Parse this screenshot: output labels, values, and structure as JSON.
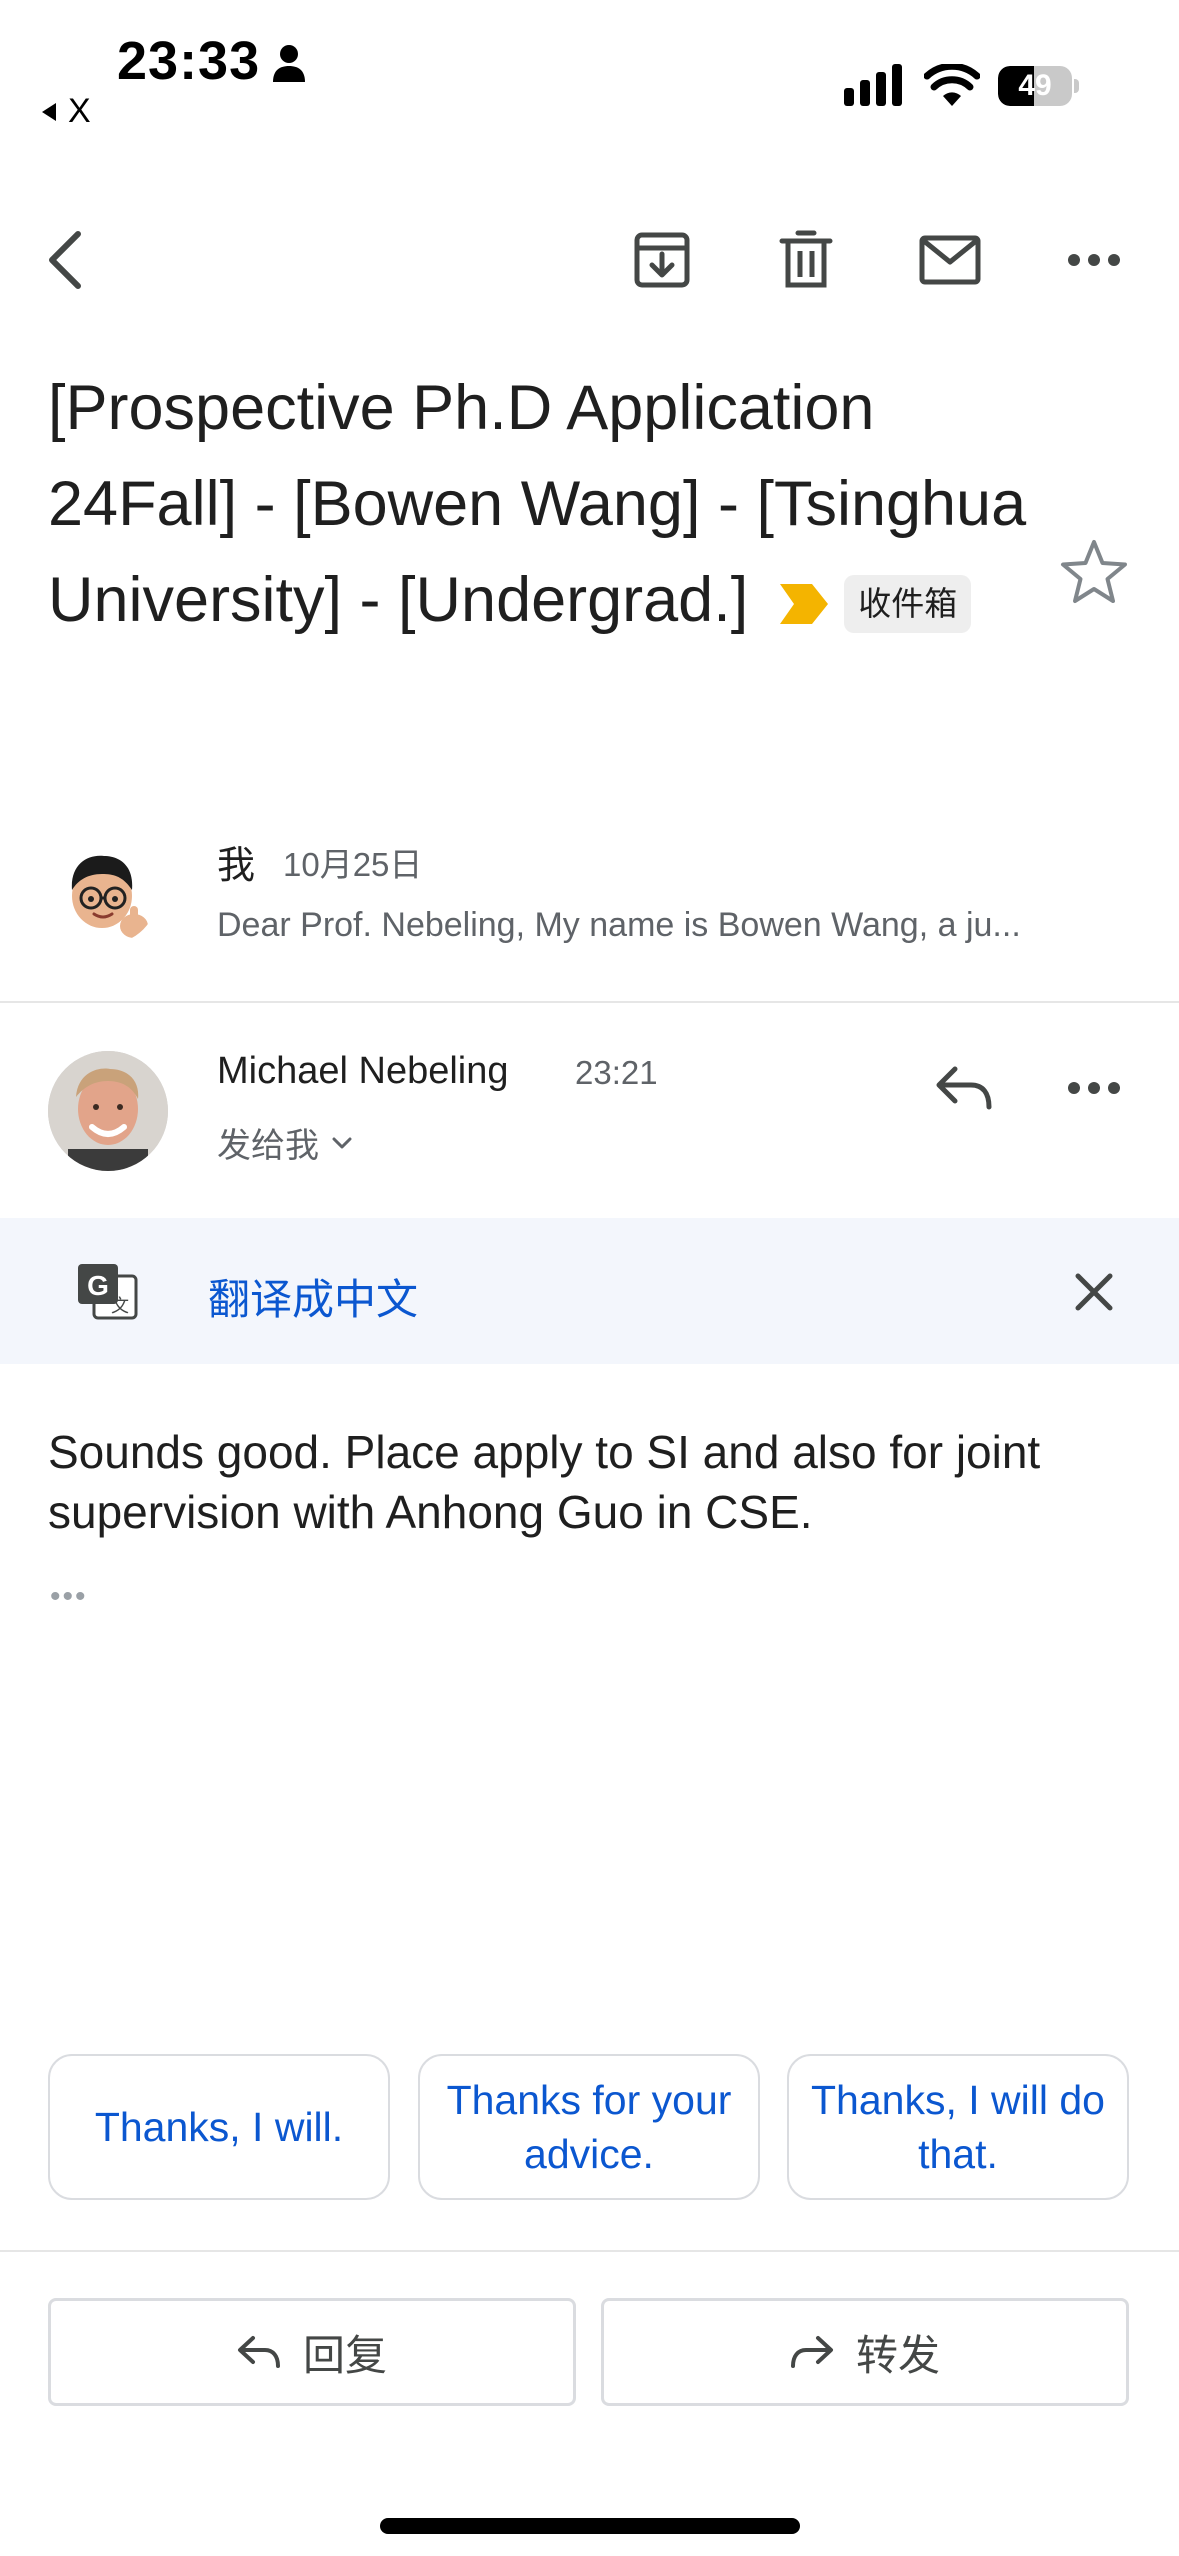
{
  "status_bar": {
    "time": "23:33",
    "back_app": "X",
    "battery_level": 49,
    "battery_text": "49"
  },
  "toolbar": {
    "back_icon": "arrow-back-icon",
    "archive_icon": "archive-icon",
    "delete_icon": "trash-icon",
    "mark_unread_icon": "mail-icon",
    "more_icon": "more-horizontal-icon"
  },
  "subject": {
    "text": "[Prospective Ph.D Application 24Fall] - [Bowen Wang] - [Tsinghua University] - [Undergrad.]",
    "label": "收件箱",
    "importance_color": "#f4b400"
  },
  "thread": [
    {
      "sender": "我",
      "date": "10月25日",
      "snippet": "Dear Prof. Nebeling, My name is Bowen Wang, a ju..."
    },
    {
      "sender": "Michael Nebeling",
      "time": "23:21",
      "recipient": "发给我",
      "translate_label": "翻译成中文",
      "body": "Sounds good. Place apply to SI and also for joint supervision with Anhong Guo in CSE.",
      "trimmed_content": "•••"
    }
  ],
  "smart_replies": [
    "Thanks, I will.",
    "Thanks for your advice.",
    "Thanks, I will do that."
  ],
  "actions": {
    "reply": "回复",
    "forward": "转发"
  },
  "colors": {
    "accent": "#0b57d0",
    "translate_bg": "#f3f6fc"
  }
}
